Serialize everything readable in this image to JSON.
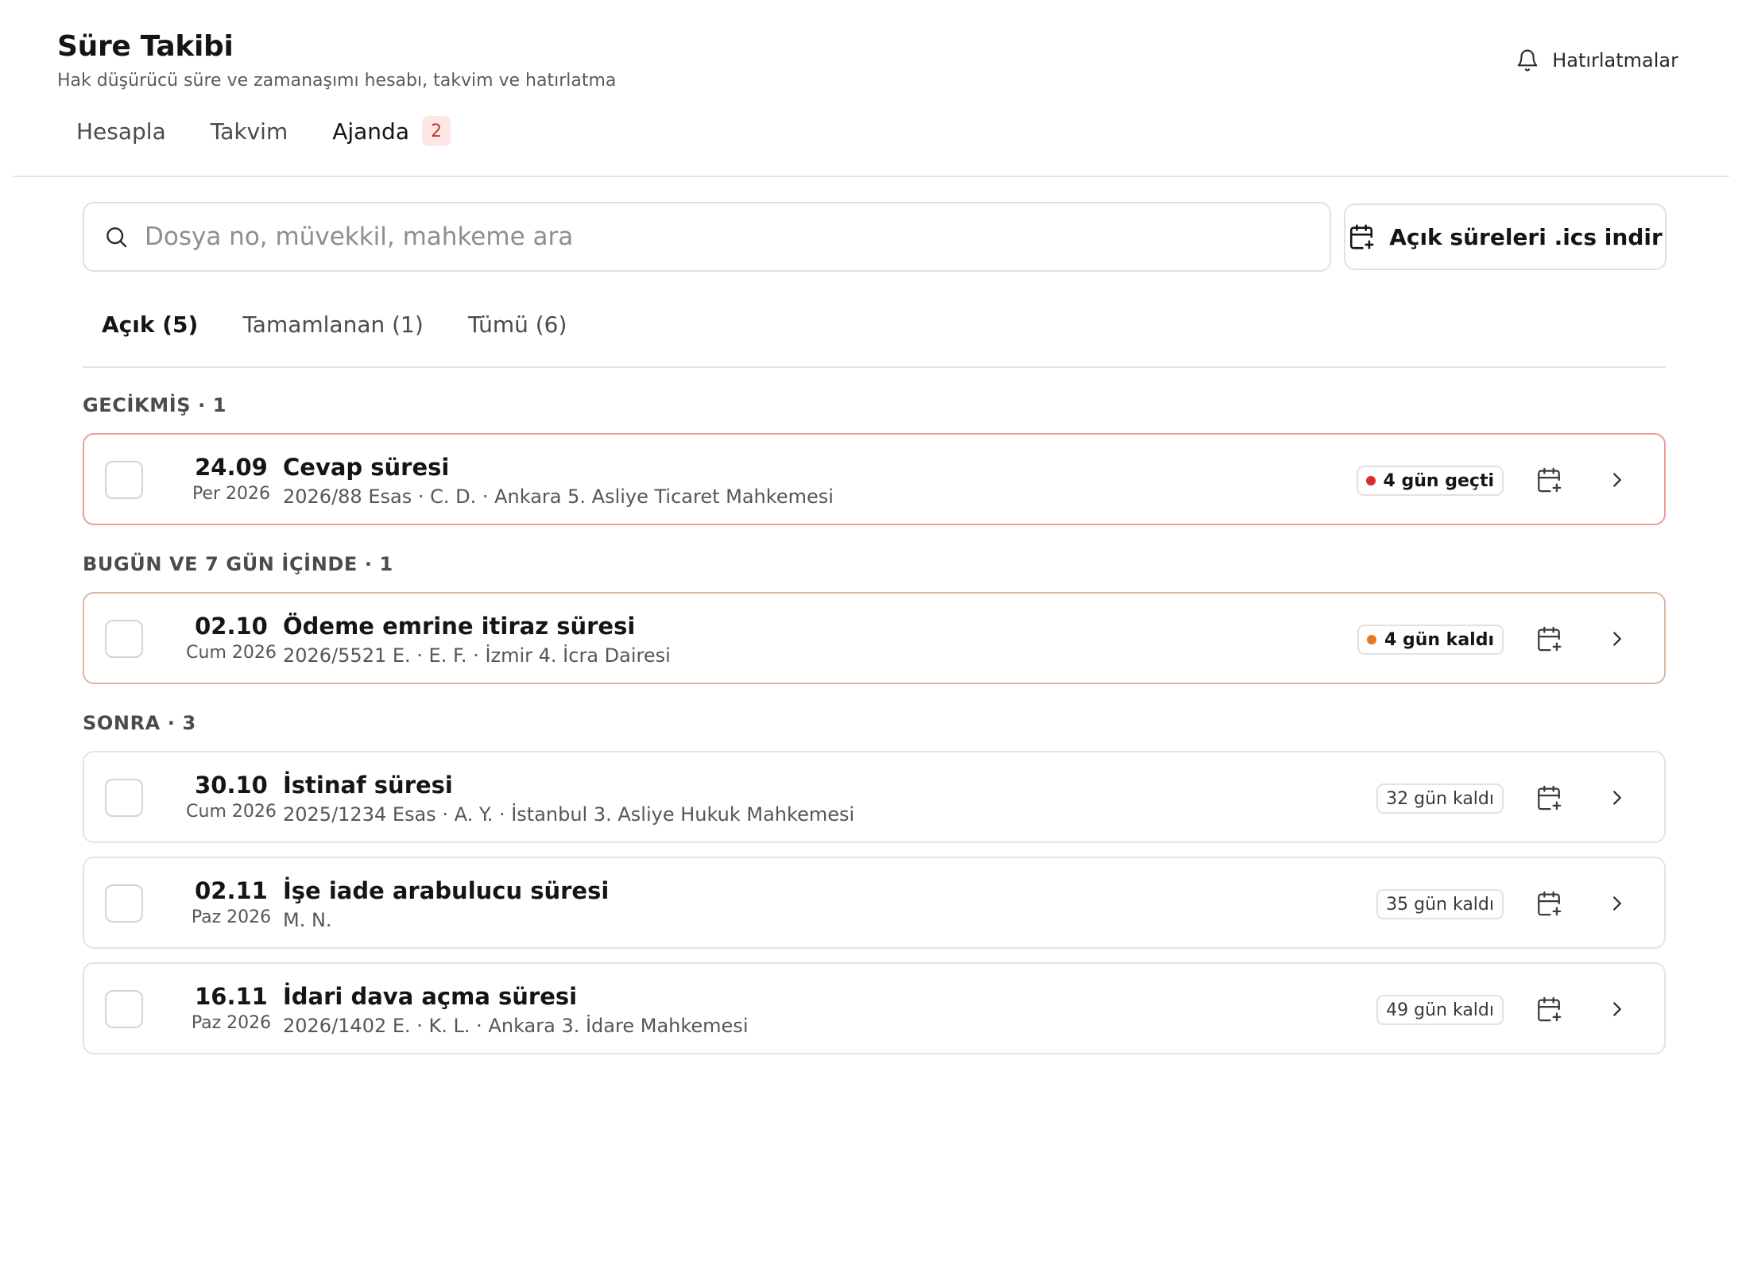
{
  "app": {
    "title": "Süre Takibi",
    "subtitle": "Hak düşürücü süre ve zamanaşımı hesabı, takvim ve hatırlatma",
    "reminders_label": "Hatırlatmalar"
  },
  "main_tabs": [
    {
      "label": "Hesapla"
    },
    {
      "label": "Takvim"
    },
    {
      "label": "Ajanda",
      "badge": "2",
      "active": true
    }
  ],
  "search": {
    "placeholder": "Dosya no, müvekkil, mahkeme ara",
    "value": ""
  },
  "ics_button": {
    "label": "Açık süreleri .ics indir",
    "icon": "calendar-plus-icon"
  },
  "filter_tabs": [
    {
      "label": "Açık (5)",
      "active": true
    },
    {
      "label": "Tamamlanan (1)"
    },
    {
      "label": "Tümü (6)"
    }
  ],
  "groups": [
    {
      "header": "GECİKMİŞ · 1",
      "items": [
        {
          "date": "24.09",
          "day_year": "Per 2026",
          "title": "Cevap süresi",
          "meta": "2026/88 Esas · C. D. · Ankara 5. Asliye Ticaret Mahkemesi",
          "status": "4 gün geçti",
          "status_color": "#d32f2f"
        }
      ]
    },
    {
      "header": "BUGÜN VE 7 GÜN İÇİNDE · 1",
      "items": [
        {
          "date": "02.10",
          "day_year": "Cum 2026",
          "title": "Ödeme emrine itiraz süresi",
          "meta": "2026/5521 E. · E. F. · İzmir 4. İcra Dairesi",
          "status": "4 gün kaldı",
          "status_color": "#e87722"
        }
      ]
    },
    {
      "header": "SONRA · 3",
      "items": [
        {
          "date": "30.10",
          "day_year": "Cum 2026",
          "title": "İstinaf süresi",
          "meta": "2025/1234 Esas · A. Y. · İstanbul 3. Asliye Hukuk Mahkemesi",
          "status": "32 gün kaldı"
        },
        {
          "date": "02.11",
          "day_year": "Paz 2026",
          "title": "İşe iade arabulucu süresi",
          "meta": "M. N.",
          "status": "35 gün kaldı"
        },
        {
          "date": "16.11",
          "day_year": "Paz 2026",
          "title": "İdari dava açma süresi",
          "meta": "2026/1402 E. · K. L. · Ankara 3. İdare Mahkemesi",
          "status": "49 gün kaldı"
        }
      ]
    }
  ],
  "colors": {
    "overdue_border": "#ef9a9a",
    "soon_border": "#dcb5a5",
    "badge_bg": "#fde6e6",
    "badge_text": "#d0312d"
  }
}
